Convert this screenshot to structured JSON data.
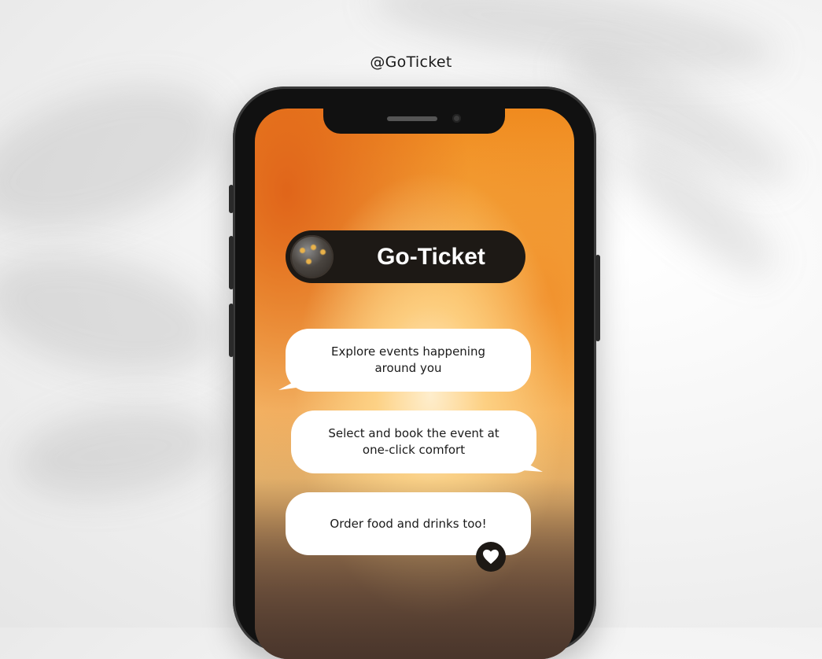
{
  "header": {
    "handle": "@GoTicket"
  },
  "app": {
    "brand_title": "Go-Ticket"
  },
  "bubbles": [
    {
      "text": "Explore events happening around you"
    },
    {
      "text": "Select and book the event at one-click comfort"
    },
    {
      "text": "Order food and drinks too!"
    }
  ],
  "icons": {
    "heart": "heart-icon",
    "brand_avatar": "brand-avatar-image"
  },
  "colors": {
    "pill_background": "#1d1915",
    "bubble_background": "#ffffff",
    "accent_orange": "#f08a1e"
  }
}
